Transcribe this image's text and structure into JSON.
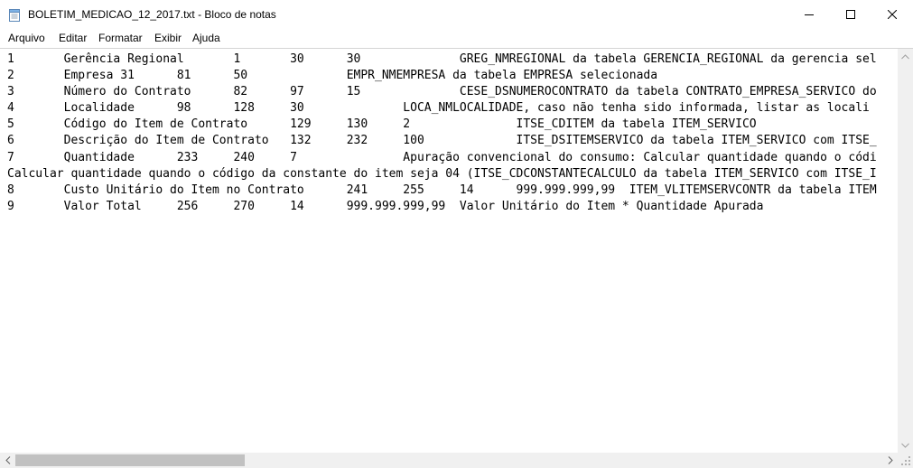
{
  "window": {
    "title": "BOLETIM_MEDICAO_12_2017.txt - Bloco de notas",
    "icon": "notepad-icon"
  },
  "menu": [
    {
      "label": "Arquivo"
    },
    {
      "label": "Editar"
    },
    {
      "label": "Formatar"
    },
    {
      "label": "Exibir"
    },
    {
      "label": "Ajuda"
    }
  ],
  "editor": {
    "lines": [
      "1\tGerência Regional\t1\t30\t30\t\tGREG_NMREGIONAL da tabela GERENCIA_REGIONAL da gerencia sel",
      "2\tEmpresa 31\t81\t50\t\tEMPR_NMEMPRESA da tabela EMPRESA selecionada",
      "3\tNúmero do Contrato\t82\t97\t15\t\tCESE_DSNUMEROCONTRATO da tabela CONTRATO_EMPRESA_SERVICO do",
      "4\tLocalidade\t98\t128\t30\t\tLOCA_NMLOCALIDADE, caso não tenha sido informada, listar as locali",
      "5\tCódigo do Item de Contrato\t129\t130\t2\t\tITSE_CDITEM da tabela ITEM_SERVICO",
      "6\tDescrição do Item de Contrato\t132\t232\t100\t\tITSE_DSITEMSERVICO da tabela ITEM_SERVICO com ITSE_",
      "7\tQuantidade\t233\t240\t7\t\tApuração convencional do consumo: Calcular quantidade quando o códi",
      "Calcular quantidade quando o código da constante do item seja 04 (ITSE_CDCONSTANTECALCULO da tabela ITEM_SERVICO com ITSE_I",
      "8\tCusto Unitário do Item no Contrato\t241\t255\t14\t999.999.999,99  ITEM_VLITEMSERVCONTR da tabela ITEM",
      "9\tValor Total\t256\t270\t14\t999.999.999,99  Valor Unitário do Item * Quantidade Apurada"
    ]
  }
}
